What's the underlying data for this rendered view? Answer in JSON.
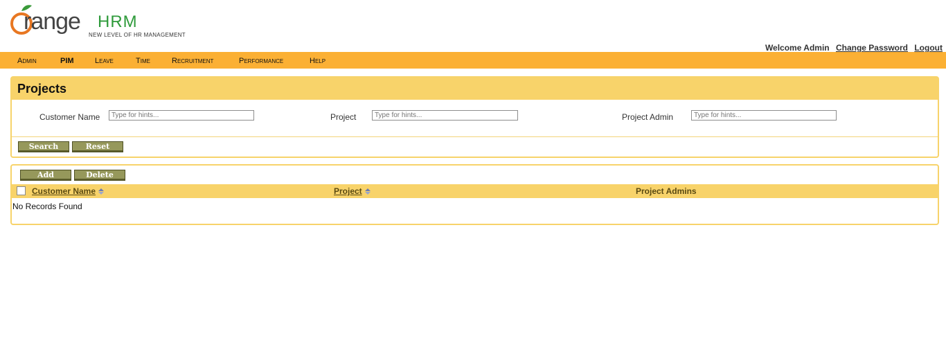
{
  "brand": {
    "name": "range",
    "name_suffix": "HRM",
    "tagline": "NEW LEVEL OF HR MANAGEMENT",
    "colors": {
      "orange": "#e87722",
      "green": "#2e9a3a",
      "nav": "#fbb034",
      "panel": "#f8d36a"
    }
  },
  "user": {
    "welcome": "Welcome Admin",
    "change_password": "Change Password",
    "logout": "Logout"
  },
  "nav": {
    "items": [
      "Admin",
      "PIM",
      "Leave",
      "Time",
      "Recruitment",
      "Performance",
      "Help"
    ],
    "active": "PIM"
  },
  "search": {
    "title": "Projects",
    "customer_label": "Customer Name",
    "project_label": "Project",
    "admin_label": "Project Admin",
    "placeholder": "Type for hints...",
    "search_button": "Search",
    "reset_button": "Reset"
  },
  "list": {
    "add_button": "Add",
    "delete_button": "Delete",
    "columns": [
      "Customer Name",
      "Project",
      "Project Admins"
    ],
    "empty_message": "No Records Found"
  }
}
